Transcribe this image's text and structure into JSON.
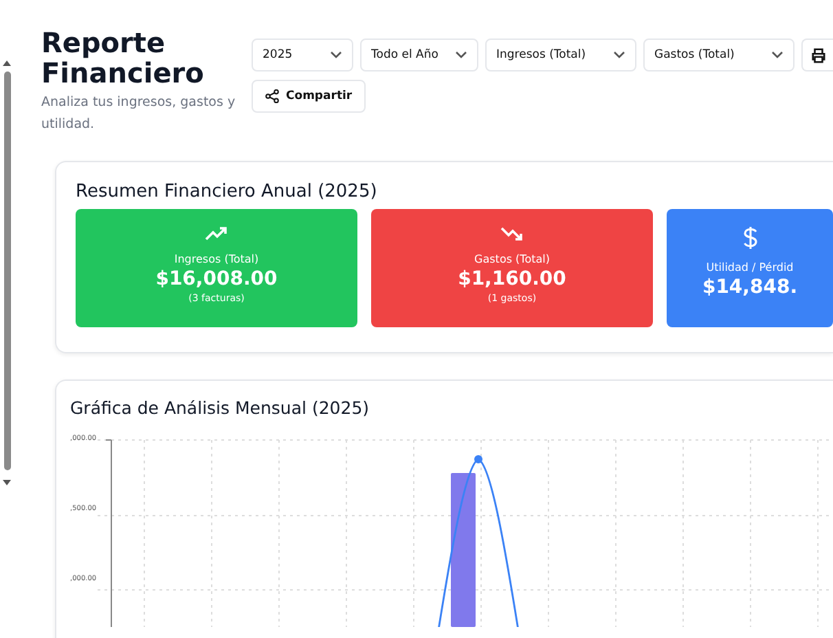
{
  "header": {
    "title": "Reporte Financiero",
    "subtitle": "Analiza tus ingresos, gastos y utilidad."
  },
  "filters": [
    {
      "value": "2025"
    },
    {
      "value": "Todo el Año"
    },
    {
      "value": "Ingresos (Total)"
    },
    {
      "value": "Gastos (Total)"
    }
  ],
  "share_button": {
    "label": "Compartir"
  },
  "summary": {
    "title": "Resumen Financiero Anual (2025)",
    "tiles": [
      {
        "kind": "up",
        "color": "#22c55e",
        "label": "Ingresos (Total)",
        "amount": "$16,008.00",
        "note": "(3 facturas)"
      },
      {
        "kind": "down",
        "color": "#ef4444",
        "label": "Gastos (Total)",
        "amount": "$1,160.00",
        "note": "(1 gastos)"
      },
      {
        "kind": "dollar",
        "color": "#3b82f6",
        "label": "Utilidad / Pérdid",
        "amount": "$14,848."
      }
    ]
  },
  "chart": {
    "title": "Gráfica de Análisis Mensual (2025)",
    "y_axis_labels": [
      ",000.00",
      ",500.00",
      ",000.00"
    ]
  }
}
